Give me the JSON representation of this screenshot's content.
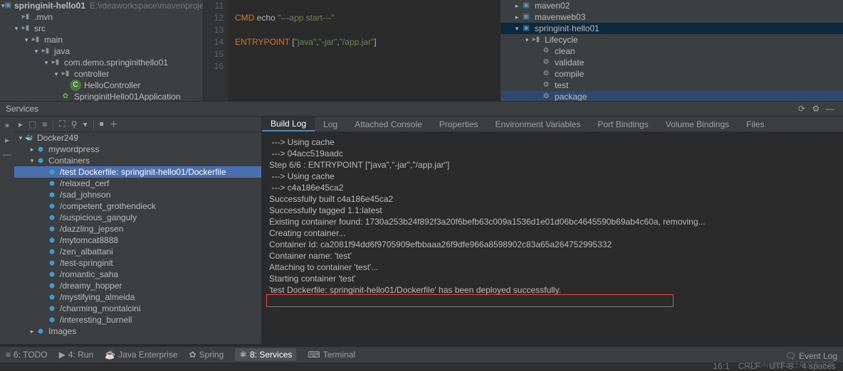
{
  "project_tree": {
    "root": {
      "name": "springinit-hello01",
      "path": "E:\\ideaworkspace\\mavenproject\\spri"
    },
    "items": [
      {
        "indent": 1,
        "arrow": "none",
        "icon": "folder",
        "label": ".mvn"
      },
      {
        "indent": 1,
        "arrow": "down",
        "icon": "folder",
        "label": "src"
      },
      {
        "indent": 2,
        "arrow": "down",
        "icon": "folder",
        "label": "main"
      },
      {
        "indent": 3,
        "arrow": "down",
        "icon": "folder",
        "label": "java"
      },
      {
        "indent": 4,
        "arrow": "down",
        "icon": "folder",
        "label": "com.demo.springinithello01"
      },
      {
        "indent": 5,
        "arrow": "down",
        "icon": "folder",
        "label": "controller"
      },
      {
        "indent": 6,
        "arrow": "none",
        "icon": "class",
        "label": "HelloController"
      },
      {
        "indent": 5,
        "arrow": "none",
        "icon": "spring",
        "label": "SpringinitHello01Application"
      }
    ]
  },
  "editor": {
    "gutter": [
      "11",
      "12",
      "13",
      "14",
      "15",
      "16"
    ],
    "lines": [
      {
        "parts": []
      },
      {
        "parts": [
          {
            "t": "kw",
            "v": "CMD"
          },
          {
            "t": "txt",
            "v": " echo "
          },
          {
            "t": "str",
            "v": "\"---app start---\""
          }
        ]
      },
      {
        "parts": []
      },
      {
        "parts": [
          {
            "t": "kw",
            "v": "ENTRYPOINT"
          },
          {
            "t": "txt",
            "v": " ["
          },
          {
            "t": "str",
            "v": "\"java\""
          },
          {
            "t": "txt",
            "v": ","
          },
          {
            "t": "str",
            "v": "\"-jar\""
          },
          {
            "t": "txt",
            "v": ","
          },
          {
            "t": "str",
            "v": "\"/app.jar\""
          },
          {
            "t": "txt",
            "v": "]"
          }
        ]
      },
      {
        "parts": []
      },
      {
        "parts": []
      }
    ]
  },
  "maven": {
    "items": [
      {
        "indent": 1,
        "arrow": "right",
        "icon": "module",
        "label": "maven02"
      },
      {
        "indent": 1,
        "arrow": "right",
        "icon": "module",
        "label": "mavenweb03"
      },
      {
        "indent": 1,
        "arrow": "down",
        "icon": "module",
        "label": "springinit-hello01",
        "sel": true
      },
      {
        "indent": 2,
        "arrow": "down",
        "icon": "folder",
        "label": "Lifecycle"
      },
      {
        "indent": 3,
        "arrow": "none",
        "icon": "gear",
        "label": "clean"
      },
      {
        "indent": 3,
        "arrow": "none",
        "icon": "gear",
        "label": "validate"
      },
      {
        "indent": 3,
        "arrow": "none",
        "icon": "gear",
        "label": "compile"
      },
      {
        "indent": 3,
        "arrow": "none",
        "icon": "gear",
        "label": "test"
      },
      {
        "indent": 3,
        "arrow": "none",
        "icon": "gear",
        "label": "package",
        "hl": true
      }
    ]
  },
  "services": {
    "title": "Services",
    "toolbar_icons": [
      "▸",
      "⬚",
      "≡",
      "⛶",
      "⚲",
      "▾",
      "⏹",
      "＋"
    ],
    "gutter_icons": [
      "✶",
      "▸",
      "—"
    ],
    "right_icons": [
      "⟳",
      "⚙",
      "—"
    ],
    "tree": [
      {
        "indent": 0,
        "arrow": "down",
        "icon": "docker",
        "label": "Docker249"
      },
      {
        "indent": 1,
        "arrow": "right",
        "icon": "pod",
        "label": "mywordpress"
      },
      {
        "indent": 1,
        "arrow": "down",
        "icon": "pod",
        "label": "Containers"
      },
      {
        "indent": 2,
        "arrow": "none",
        "icon": "pod",
        "label": "/test Dockerfile: springinit-hello01/Dockerfile",
        "sel": true
      },
      {
        "indent": 2,
        "arrow": "none",
        "icon": "pod",
        "label": "/relaxed_cerf"
      },
      {
        "indent": 2,
        "arrow": "none",
        "icon": "pod",
        "label": "/sad_johnson"
      },
      {
        "indent": 2,
        "arrow": "none",
        "icon": "pod",
        "label": "/competent_grothendieck"
      },
      {
        "indent": 2,
        "arrow": "none",
        "icon": "pod",
        "label": "/suspicious_ganguly"
      },
      {
        "indent": 2,
        "arrow": "none",
        "icon": "pod",
        "label": "/dazzling_jepsen"
      },
      {
        "indent": 2,
        "arrow": "none",
        "icon": "pod",
        "label": "/mytomcat8888"
      },
      {
        "indent": 2,
        "arrow": "none",
        "icon": "pod",
        "label": "/zen_albattani"
      },
      {
        "indent": 2,
        "arrow": "none",
        "icon": "pod",
        "label": "/test-springinit"
      },
      {
        "indent": 2,
        "arrow": "none",
        "icon": "pod",
        "label": "/romantic_saha"
      },
      {
        "indent": 2,
        "arrow": "none",
        "icon": "pod",
        "label": "/dreamy_hopper"
      },
      {
        "indent": 2,
        "arrow": "none",
        "icon": "pod",
        "label": "/mystifying_almeida"
      },
      {
        "indent": 2,
        "arrow": "none",
        "icon": "pod",
        "label": "/charming_montalcini"
      },
      {
        "indent": 2,
        "arrow": "none",
        "icon": "pod",
        "label": "/interesting_burnell"
      },
      {
        "indent": 1,
        "arrow": "right",
        "icon": "pod",
        "label": "Images"
      }
    ],
    "tabs": [
      "Build Log",
      "Log",
      "Attached Console",
      "Properties",
      "Environment Variables",
      "Port Bindings",
      "Volume Bindings",
      "Files"
    ],
    "active_tab": 0,
    "log_lines": [
      " ---> Using cache",
      " ---> 04acc519aadc",
      "Step 6/6 : ENTRYPOINT [\"java\",\"-jar\",\"/app.jar\"]",
      " ---> Using cache",
      " ---> c4a186e45ca2",
      "",
      "Successfully built c4a186e45ca2",
      "Successfully tagged 1.1:latest",
      "Existing container found: 1730a253b24f892f3a20f6befb63c009a1536d1e01d06bc4645590b69ab4c60a, removing...",
      "Creating container...",
      "Container Id: ca2081f94dd6f9705909efbbaaa26f9dfe966a8598902c83a65a264752995332",
      "Container name: 'test'",
      "Attaching to container 'test'...",
      "Starting container 'test'",
      "'test Dockerfile: springinit-hello01/Dockerfile' has been deployed successfully."
    ],
    "highlight_line_index": 14
  },
  "bottom": {
    "items": [
      {
        "icon": "≡",
        "label": "6: TODO"
      },
      {
        "icon": "▶",
        "label": "4: Run"
      },
      {
        "icon": "☕",
        "label": "Java Enterprise"
      },
      {
        "icon": "✿",
        "label": "Spring"
      },
      {
        "icon": "⚛",
        "label": "8: Services",
        "active": true
      },
      {
        "icon": "⌨",
        "label": "Terminal"
      }
    ],
    "event_log": "Event Log"
  },
  "status": {
    "pos": "16:1",
    "sep1": "CRLF",
    "enc": "UTF-8",
    "indent": "4 spaces"
  },
  "watermark": "CSDN @逆水行舟没有退路"
}
